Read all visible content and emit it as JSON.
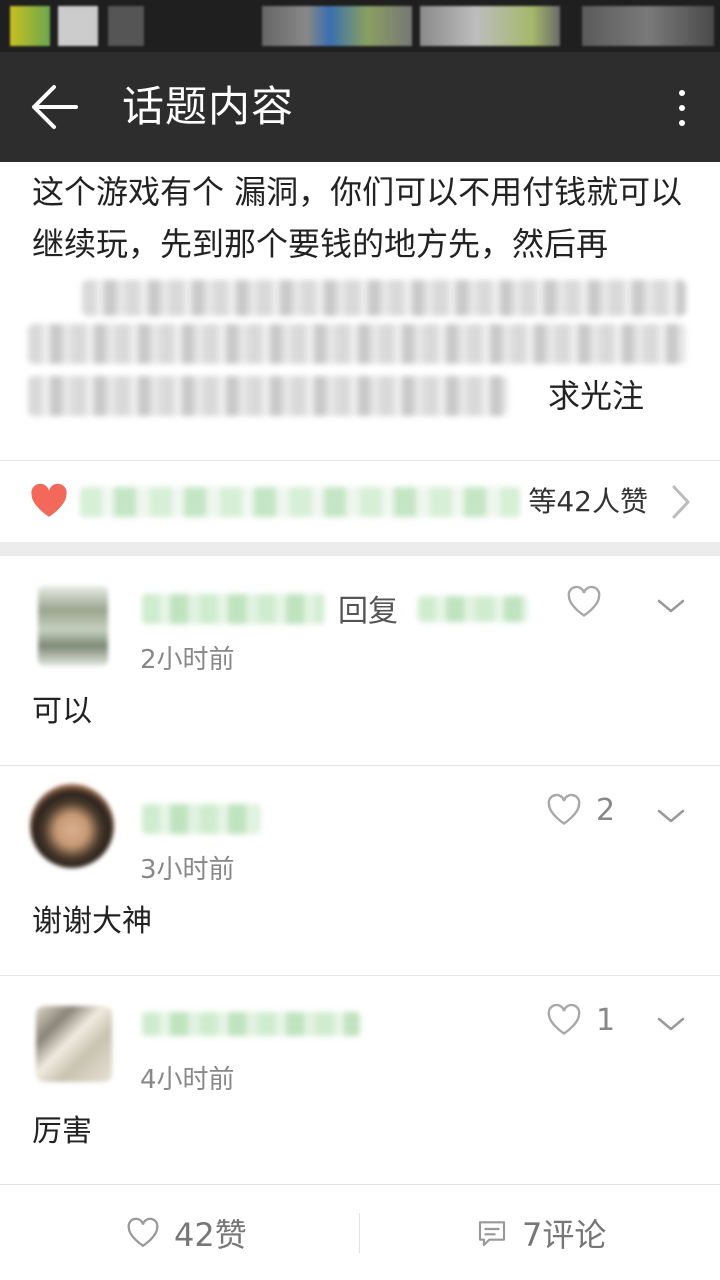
{
  "app_bar": {
    "title": "话题内容"
  },
  "post": {
    "text_visible": "这个游戏有个 漏洞，你们可以不用付钱就可以继续玩，先到那个要钱的地方先，然后再",
    "text_end": "求光注",
    "likes_summary": "等42人赞"
  },
  "comments": [
    {
      "reply_word": "回复",
      "time": "2小时前",
      "text": "可以",
      "like_count": ""
    },
    {
      "reply_word": "",
      "time": "3小时前",
      "text": "谢谢大神",
      "like_count": "2"
    },
    {
      "reply_word": "",
      "time": "4小时前",
      "text": "厉害",
      "like_count": "1"
    }
  ],
  "bottom_bar": {
    "like_label": "42赞",
    "comment_label": "7评论"
  },
  "colors": {
    "app_bar_bg": "#2d2d2d",
    "heart_red": "#f2685a",
    "icon_gray": "#999999"
  },
  "icons": [
    "back-arrow-icon",
    "more-vert-icon",
    "heart-filled-icon",
    "chevron-right-icon",
    "heart-outline-icon",
    "chevron-down-icon",
    "comment-icon"
  ]
}
